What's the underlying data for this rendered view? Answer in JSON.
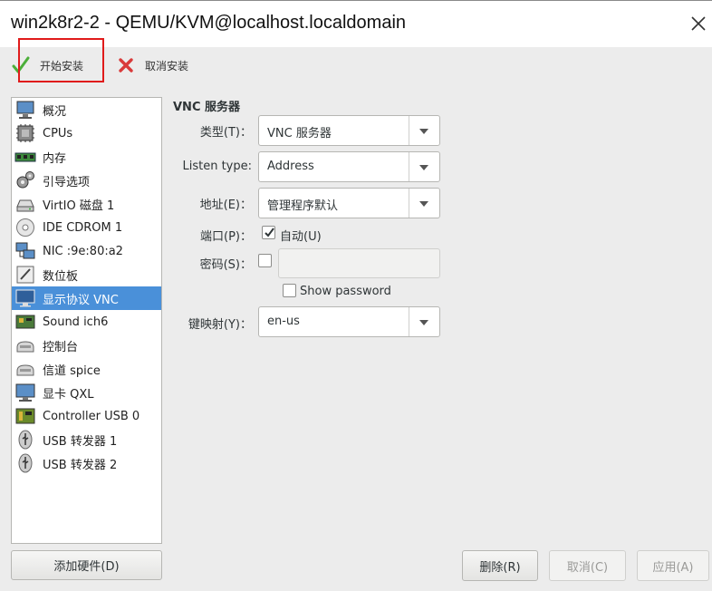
{
  "window": {
    "title": "win2k8r2-2 - QEMU/KVM@localhost.localdomain"
  },
  "toolbar": {
    "begin_install": "开始安装",
    "cancel_install": "取消安装"
  },
  "hardware_list": [
    {
      "label": "概况",
      "icon": "overview-icon"
    },
    {
      "label": "CPUs",
      "icon": "cpu-icon"
    },
    {
      "label": "内存",
      "icon": "memory-icon"
    },
    {
      "label": "引导选项",
      "icon": "boot-options-icon"
    },
    {
      "label": "VirtIO 磁盘 1",
      "icon": "disk-icon"
    },
    {
      "label": "IDE CDROM 1",
      "icon": "cdrom-icon"
    },
    {
      "label": "NIC :9e:80:a2",
      "icon": "network-icon"
    },
    {
      "label": "数位板",
      "icon": "tablet-icon"
    },
    {
      "label": "显示协议 VNC",
      "icon": "display-icon",
      "selected": true
    },
    {
      "label": "Sound ich6",
      "icon": "sound-card-icon"
    },
    {
      "label": "控制台",
      "icon": "console-icon"
    },
    {
      "label": "信道 spice",
      "icon": "channel-icon"
    },
    {
      "label": "显卡 QXL",
      "icon": "video-card-icon"
    },
    {
      "label": "Controller USB 0",
      "icon": "controller-icon"
    },
    {
      "label": "USB 转发器 1",
      "icon": "usb-icon"
    },
    {
      "label": "USB 转发器 2",
      "icon": "usb-icon"
    }
  ],
  "add_hardware": "添加硬件(D)",
  "details": {
    "section_title": "VNC 服务器",
    "type_label": "类型(T)：",
    "type_value": "VNC 服务器",
    "listen_label": "Listen type:",
    "listen_value": "Address",
    "address_label": "地址(E)：",
    "address_value": "管理程序默认",
    "port_label": "端口(P)：",
    "port_auto_label": "自动(U)",
    "port_auto_checked": true,
    "password_label": "密码(S)：",
    "password_checked": false,
    "show_password_label": "Show password",
    "keymap_label": "键映射(Y)：",
    "keymap_value": "en-us"
  },
  "buttons": {
    "remove": "删除(R)",
    "cancel": "取消(C)",
    "apply": "应用(A)"
  },
  "colors": {
    "selection": "#4a90d9",
    "highlight_box": "#e01b1b",
    "install_check": "#4caf3a",
    "cancel_x": "#d93a3a"
  }
}
